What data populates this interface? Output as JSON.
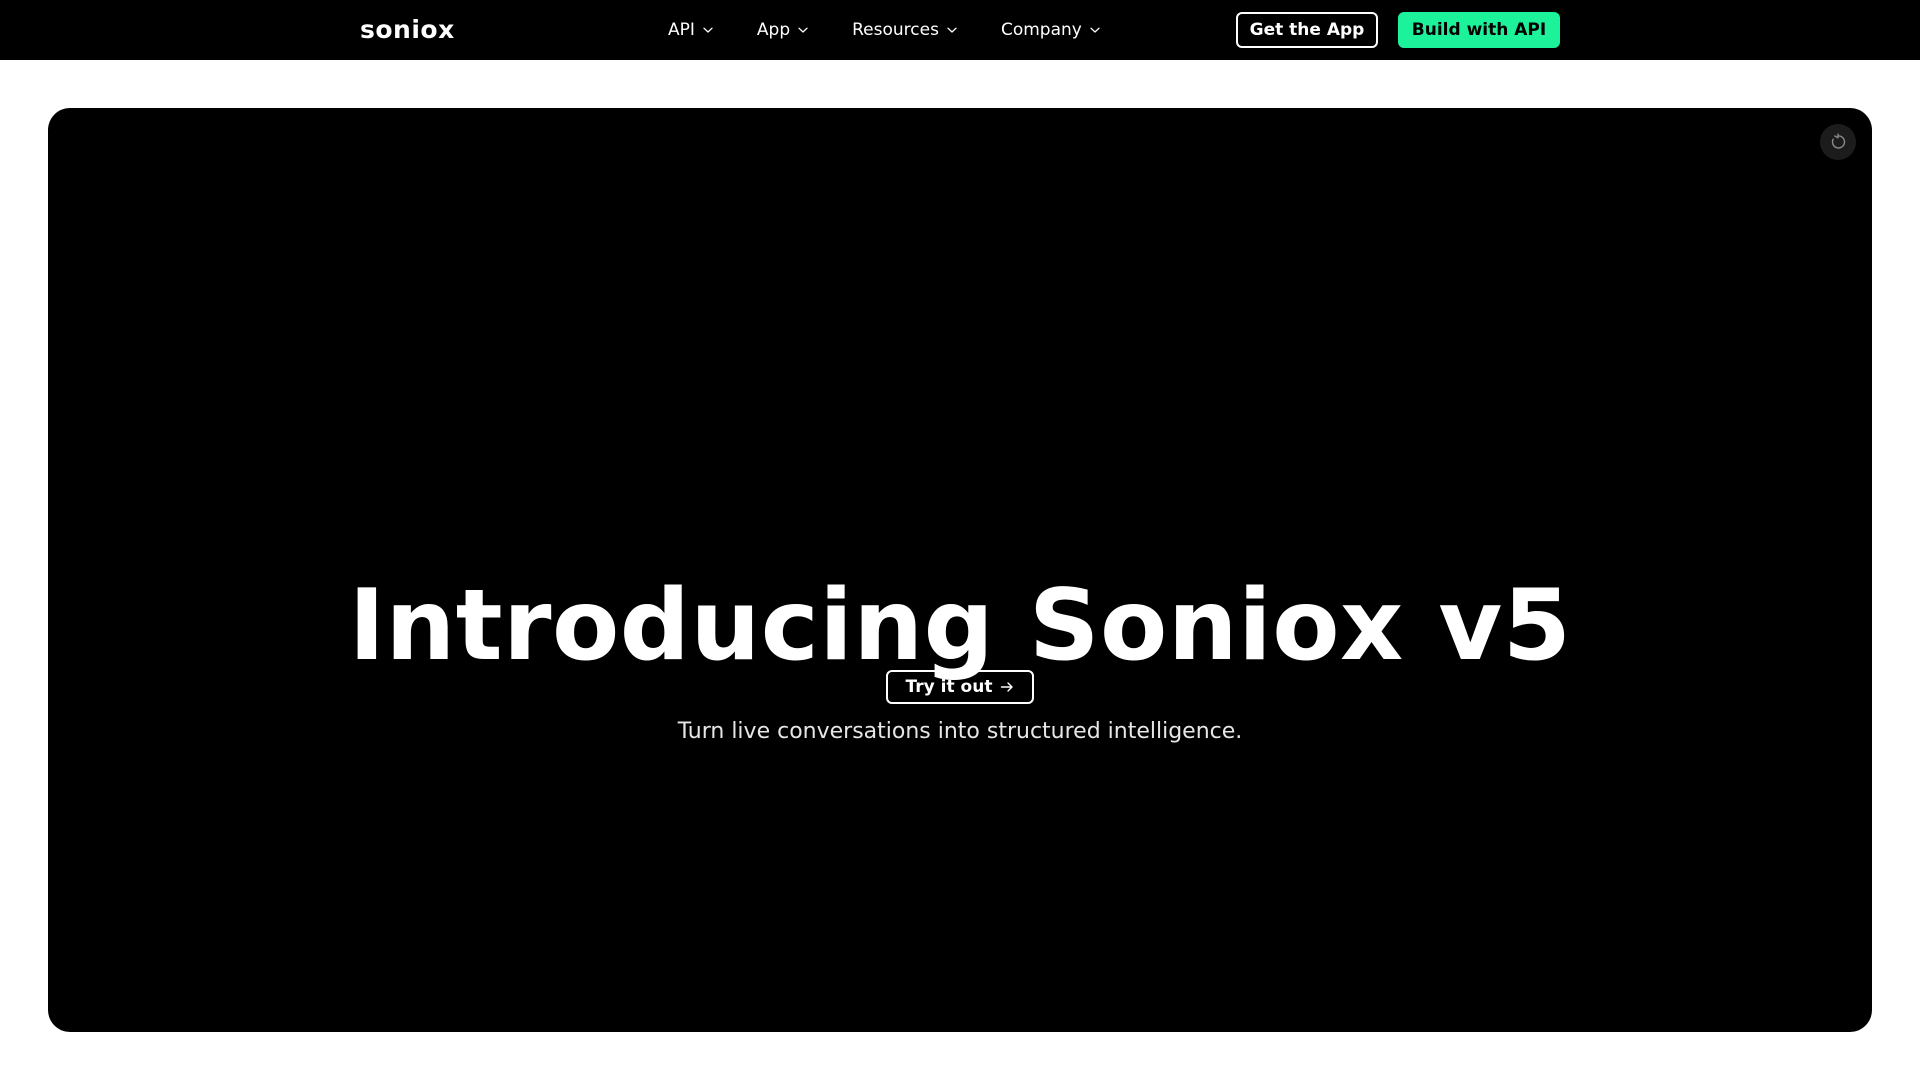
{
  "nav": {
    "logo": "soniox",
    "items": [
      {
        "label": "API"
      },
      {
        "label": "App"
      },
      {
        "label": "Resources"
      },
      {
        "label": "Company"
      }
    ],
    "get_app_label": "Get the App",
    "build_api_label": "Build with API"
  },
  "hero": {
    "title": "Introducing Soniox v5",
    "subtitle": "Turn live conversations into structured intelligence.",
    "cta_label": "Try it out"
  },
  "colors": {
    "background": "#ffffff",
    "nav_background": "#000000",
    "hero_background": "#000000",
    "accent": "#1cf29a",
    "text_light": "#ffffff"
  },
  "icons": {
    "nav_chevron": "chevron-down-icon",
    "cta_arrow": "arrow-right-icon",
    "replay": "replay-icon"
  }
}
